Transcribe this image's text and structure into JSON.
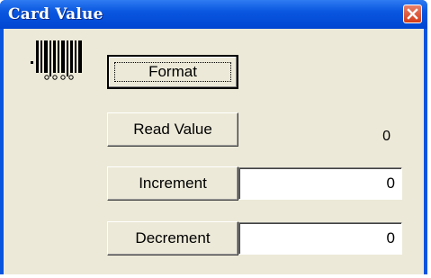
{
  "window": {
    "title": "Card Value"
  },
  "icons": {
    "barcode": "barcode-icon",
    "close": "close-icon"
  },
  "buttons": {
    "format": "Format",
    "read_value": "Read Value",
    "increment": "Increment",
    "decrement": "Decrement"
  },
  "read_value_result": "0",
  "increment_value": "0",
  "decrement_value": "0",
  "colors": {
    "titlebar": "#0a55de",
    "close_button": "#d43c18",
    "dialog_bg": "#ece9d8"
  }
}
